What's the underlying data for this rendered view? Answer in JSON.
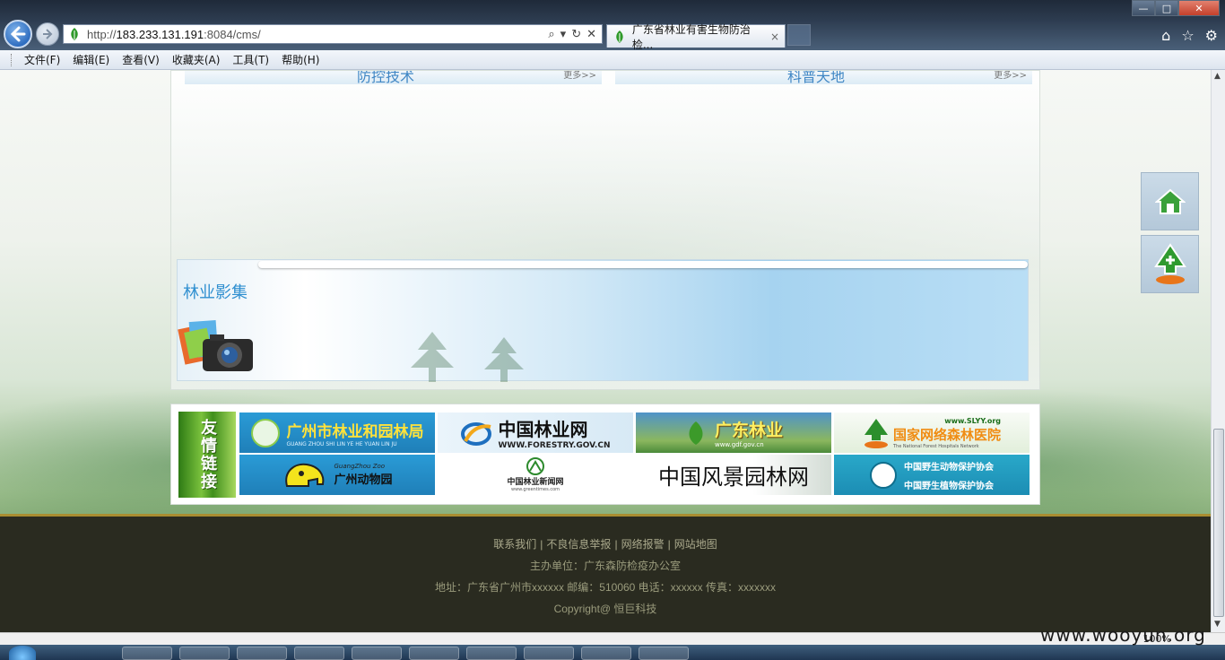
{
  "browser": {
    "url_prefix": "http://",
    "url_host": "183.233.131.191",
    "url_rest": ":8084/cms/",
    "tab_title": "广东省林业有害生物防治检...",
    "tab_close": "×",
    "window_min": "—",
    "window_max": "□",
    "window_close": "✕"
  },
  "menubar": {
    "items": [
      "文件(F)",
      "编辑(E)",
      "查看(V)",
      "收藏夹(A)",
      "工具(T)",
      "帮助(H)"
    ]
  },
  "page": {
    "section_left": {
      "title": "防控技术",
      "more": "更多>>"
    },
    "section_right": {
      "title": "科普天地",
      "more": "更多>>"
    },
    "gallery_title": "林业影集",
    "links_label": "友情链接",
    "links": {
      "gz_forestry": {
        "title": "广州市林业和园林局",
        "sub": "GUANG ZHOU SHI LIN YE HE YUAN LIN JU"
      },
      "forestry_gov": {
        "title": "中国林业网",
        "sub": "WWW.FORESTRY.GOV.CN"
      },
      "gd_forestry": {
        "title": "广东林业",
        "sub": "www.gdf.gov.cn"
      },
      "forest_hospital": {
        "title": "国家网络森林医院",
        "url": "www.SLYY.org",
        "sub": "The National Forest Hospitals Network"
      },
      "gz_zoo": {
        "title": "广州动物园",
        "sub": "GuangZhou Zoo"
      },
      "greentimes": {
        "title": "中国林业新闻网",
        "sub": "www.greentimes.com"
      },
      "landscape": {
        "title": "中国风景园林网"
      },
      "wildlife": {
        "title_top": "中国野生动物保护协会",
        "title_bottom": "中国野生植物保护协会"
      }
    },
    "footer": {
      "links": [
        "联系我们",
        "不良信息举报",
        "网络报警",
        "网站地图"
      ],
      "separator": "|",
      "sponsor": "主办单位：广东森防检疫办公室",
      "address": "地址：广东省广州市xxxxxx 邮编：510060 电话：xxxxxx 传真：xxxxxxx",
      "copyright": "Copyright@ 恒巨科技"
    }
  },
  "statusbar": {
    "zoom": "100%"
  },
  "watermark": "www.wooyun.org",
  "colors": {
    "footer_bg": "#2a2b20",
    "footer_border": "#a98d31",
    "accent_blue": "#3f86c4"
  }
}
